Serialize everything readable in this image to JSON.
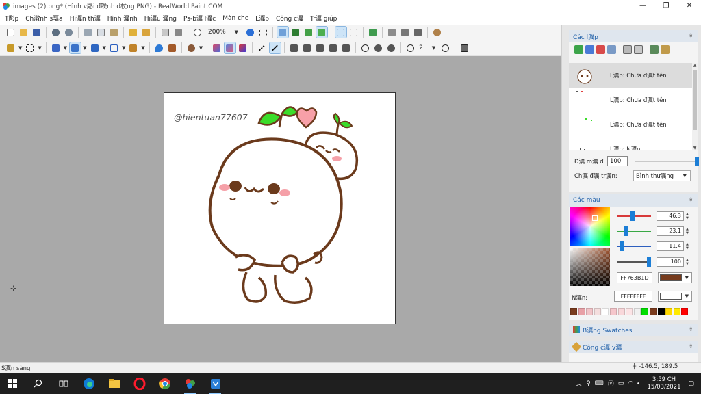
{
  "window": {
    "title": "images (2).png* (Hình v彫i đ咲nh d杖ng PNG) - RealWorld Paint.COM",
    "min": "—",
    "max": "❐",
    "close": "✕"
  },
  "menu": [
    "T彫p",
    "Ch澂nh s戛a",
    "Hi濿n th濿",
    "Hình 濿nh",
    "Hi濿u 濿ng",
    "Ps-b濿 l濿c",
    "Màn che",
    "L濿p",
    "Công c濿",
    "Tr濿 giúp"
  ],
  "toolbar": {
    "zoom": "200%",
    "dropdown": "▼",
    "brush_size": "2"
  },
  "canvas": {
    "watermark": "@hientuan77607"
  },
  "layers_panel": {
    "title": "Các l濿p",
    "collapse": "⇞",
    "items": [
      {
        "name": "L濿p: Chưa đ濿t tên"
      },
      {
        "name": "L濿p: Chưa đ濿t tên"
      },
      {
        "name": "L濿p: Chưa đ濿t tên"
      },
      {
        "name": "L濿p: N濿n"
      }
    ],
    "opacity_label": "Đ濿 m濿 đ",
    "opacity_value": "100",
    "blend_label": "Ch濿 đ濿 tr濿n:",
    "blend_value": "Bình thư濿ng"
  },
  "colors_panel": {
    "title": "Các màu",
    "collapse": "⇞",
    "channels": [
      {
        "value": "46.3",
        "level": 0.46,
        "color": "#d83a3a"
      },
      {
        "value": "23.1",
        "level": 0.23,
        "color": "#39a845"
      },
      {
        "value": "11.4",
        "level": 0.11,
        "color": "#2d5fbf"
      },
      {
        "value": "100",
        "level": 1.0,
        "color": "#555555"
      }
    ],
    "primary_hex": "FF763B1D",
    "primary_color": "#763B1D",
    "background_label": "N濿n:",
    "background_hex": "FFFFFFFF",
    "background_color": "#FFFFFF",
    "palette": [
      "#7a3b1d",
      "#e8a0a6",
      "#f2c4c8",
      "#f4dede",
      "#ffffff",
      "#f5c6cb",
      "#f9d7da",
      "#fce4e6",
      "#f0f0f0",
      "#00dd00",
      "#7a3b1d",
      "#000000",
      "#ffd800",
      "#ffea00",
      "#ff0000"
    ]
  },
  "swatches_panel": {
    "title": "B濿ng Swatches",
    "collapse": "⇟"
  },
  "tools_panel": {
    "title": "Công c濿 v濿",
    "collapse": "⇟"
  },
  "status": {
    "text": "S濿n sàng",
    "coords": "-146.5, 189.5"
  },
  "taskbar": {
    "time": "3:59 CH",
    "date": "15/03/2021"
  }
}
